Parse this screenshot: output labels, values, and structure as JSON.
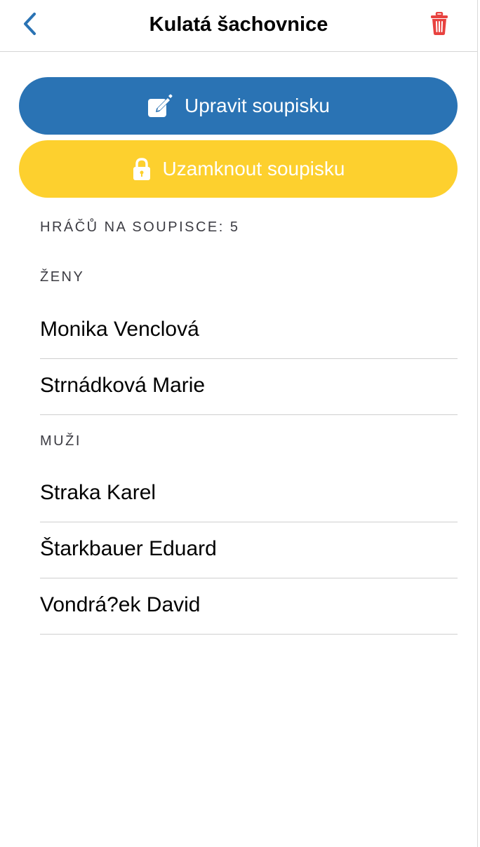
{
  "navbar": {
    "title": "Kulatá šachovnice",
    "back_icon": "chevron-left-icon",
    "trash_icon": "trash-icon",
    "accent_color": "#2a73b4",
    "danger_color": "#e8423f"
  },
  "actions": {
    "edit_label": "Upravit soupisku",
    "edit_icon": "edit-icon",
    "edit_color": "#2a73b4",
    "lock_label": "Uzamknout soupisku",
    "lock_icon": "lock-icon",
    "lock_color": "#fdd02e"
  },
  "roster": {
    "count_label": "HRÁČŮ NA SOUPISCE: 5",
    "sections": [
      {
        "title": "ŽENY",
        "players": [
          "Monika Venclová",
          "Strnádková Marie"
        ]
      },
      {
        "title": "MUŽI",
        "players": [
          "Straka Karel",
          "Štarkbauer Eduard",
          "Vondrá?ek David"
        ]
      }
    ]
  }
}
